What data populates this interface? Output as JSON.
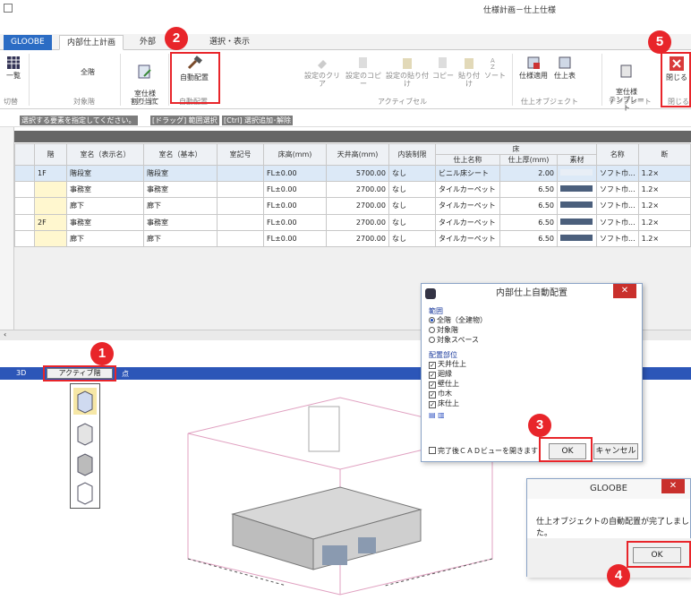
{
  "window": {
    "title": "仕様計画－仕上仕様"
  },
  "tabs": [
    "GLOOBE",
    "内部仕上計画",
    "外部",
    "選択・表示"
  ],
  "ribbon": {
    "groups": {
      "switch": "切替",
      "target_floor": "対象階",
      "room_spec": "室仕様",
      "auto": "自動配置",
      "active_cell": "アクティブセル",
      "finish_object": "仕上オブジェクト",
      "template": "テンプレート",
      "close": "閉じる"
    },
    "buttons": {
      "list": "一覧",
      "all_floors": "全階",
      "assign": "室仕様\n割り当て",
      "auto_arrange": "自動配置",
      "clear": "設定のクリア",
      "copy": "設定のコピー",
      "paste": "設定の貼り付け",
      "copy2": "コピー",
      "paste2": "貼り付け",
      "sort": "ソート",
      "apply": "仕様適用",
      "table": "仕上表",
      "template": "室仕様\nテンプレート",
      "close": "閉じる"
    }
  },
  "hints": [
    "選択する要素を指定してください。",
    "[ドラッグ] 範囲選択",
    "[Ctrl] 選択追加･解除"
  ],
  "grid": {
    "headers": {
      "floor": "階",
      "room_disp": "室名（表示名）",
      "room_base": "室名（基本）",
      "room_code": "室記号",
      "floor_h": "床高(mm)",
      "ceiling_h": "天井高(mm)",
      "interior": "内装制限",
      "floor_group": "床",
      "finish_name": "仕上名称",
      "finish_thk": "仕上厚(mm)",
      "material": "素材",
      "name": "名称",
      "more": "断"
    },
    "rows": [
      {
        "floor": "1F",
        "room_disp": "階段室",
        "room_base": "階段室",
        "code": "",
        "fh": "FL±0.00",
        "ch": "5700.00",
        "lim": "なし",
        "fin": "ビニル床シート",
        "thk": "2.00",
        "nm": "ソフト巾...",
        "x": "1.2×"
      },
      {
        "floor": "",
        "room_disp": "事務室",
        "room_base": "事務室",
        "code": "",
        "fh": "FL±0.00",
        "ch": "2700.00",
        "lim": "なし",
        "fin": "タイルカーペット",
        "thk": "6.50",
        "nm": "ソフト巾...",
        "x": "1.2×"
      },
      {
        "floor": "",
        "room_disp": "廊下",
        "room_base": "廊下",
        "code": "",
        "fh": "FL±0.00",
        "ch": "2700.00",
        "lim": "なし",
        "fin": "タイルカーペット",
        "thk": "6.50",
        "nm": "ソフト巾...",
        "x": "1.2×"
      },
      {
        "floor": "2F",
        "room_disp": "事務室",
        "room_base": "事務室",
        "code": "",
        "fh": "FL±0.00",
        "ch": "2700.00",
        "lim": "なし",
        "fin": "タイルカーペット",
        "thk": "6.50",
        "nm": "ソフト巾...",
        "x": "1.2×"
      },
      {
        "floor": "",
        "room_disp": "廊下",
        "room_base": "廊下",
        "code": "",
        "fh": "FL±0.00",
        "ch": "2700.00",
        "lim": "なし",
        "fin": "タイルカーペット",
        "thk": "6.50",
        "nm": "ソフト巾...",
        "x": "1.2×"
      }
    ]
  },
  "viewbar": {
    "label": "3D",
    "active_floor": "アクティブ階",
    "suffix": "点"
  },
  "dialog1": {
    "title": "内部仕上自動配置",
    "range_label": "範囲",
    "ranges": [
      "全階（全建物）",
      "対象階",
      "対象スペース"
    ],
    "parts_label": "配置部位",
    "parts": [
      "天井仕上",
      "廻縁",
      "壁仕上",
      "巾木",
      "床仕上"
    ],
    "open_cad": "完了後ＣＡＤビューを開きます",
    "ok": "OK",
    "cancel": "キャンセル"
  },
  "dialog2": {
    "title": "GLOOBE",
    "message": "仕上オブジェクトの自動配置が完了しました。",
    "ok": "OK"
  },
  "callouts": [
    "1",
    "2",
    "3",
    "4",
    "5"
  ]
}
